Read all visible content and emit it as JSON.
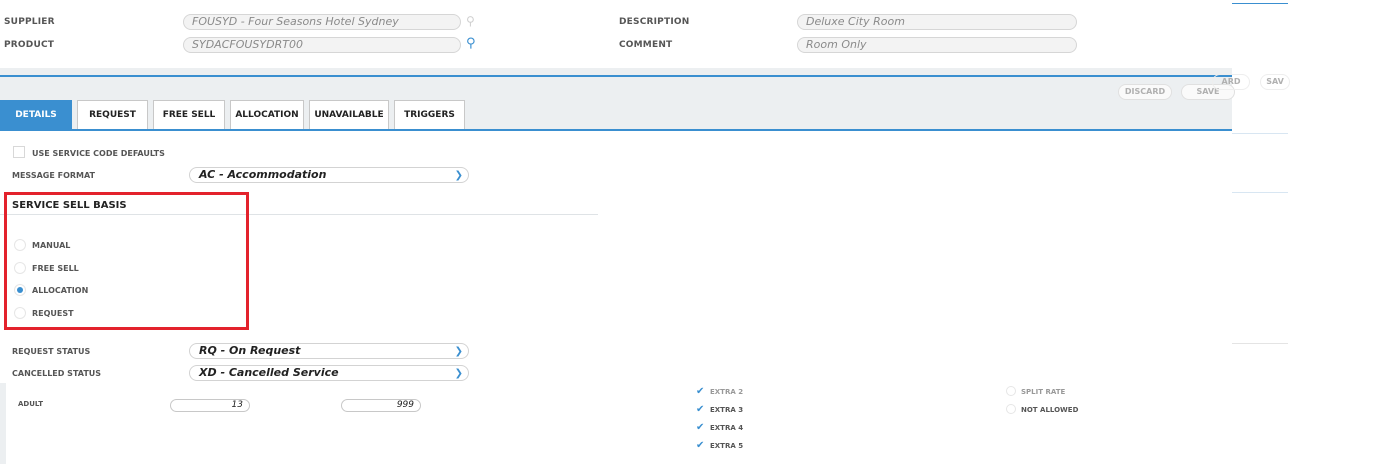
{
  "header": {
    "supplier_label": "SUPPLIER",
    "supplier_value": "FOUSYD - Four Seasons Hotel Sydney",
    "product_label": "PRODUCT",
    "product_value": "SYDACFOUSYDRT00",
    "description_label": "DESCRIPTION",
    "description_value": "Deluxe City Room",
    "comment_label": "COMMENT",
    "comment_value": "Room Only"
  },
  "toolbar": {
    "discard_label": "DISCARD",
    "save_label": "SAVE",
    "ghost_discard": "ARD",
    "ghost_save": "SAV"
  },
  "tabs": [
    {
      "label": "DETAILS",
      "active": true
    },
    {
      "label": "REQUEST",
      "active": false
    },
    {
      "label": "FREE SELL",
      "active": false
    },
    {
      "label": "ALLOCATION",
      "active": false
    },
    {
      "label": "UNAVAILABLE",
      "active": false
    },
    {
      "label": "TRIGGERS",
      "active": false
    }
  ],
  "details": {
    "use_defaults_label": "USE SERVICE CODE DEFAULTS",
    "message_format_label": "MESSAGE FORMAT",
    "message_format_value": "AC - Accommodation",
    "sell_basis_title": "SERVICE SELL BASIS",
    "sell_basis_options": [
      {
        "label": "MANUAL",
        "selected": false
      },
      {
        "label": "FREE SELL",
        "selected": false
      },
      {
        "label": "ALLOCATION",
        "selected": true
      },
      {
        "label": "REQUEST",
        "selected": false
      }
    ],
    "request_status_label": "REQUEST STATUS",
    "request_status_value": "RQ - On Request",
    "cancelled_status_label": "CANCELLED STATUS",
    "cancelled_status_value": "XD - Cancelled Service"
  },
  "background": {
    "adult_label": "ADULT",
    "adult_min": "13",
    "adult_max": "999",
    "extras": [
      "EXTRA 2",
      "EXTRA 3",
      "EXTRA 4",
      "EXTRA 5"
    ],
    "split_rate_label": "SPLIT RATE",
    "not_allowed_label": "NOT ALLOWED"
  },
  "colors": {
    "accent": "#3a8fd0",
    "highlight": "#e3222c"
  }
}
